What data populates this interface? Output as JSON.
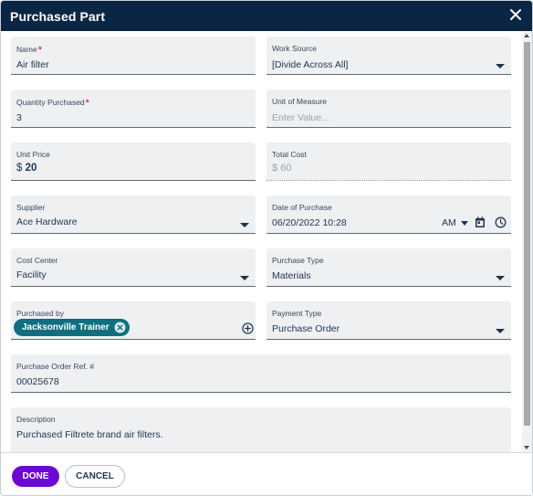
{
  "header": {
    "title": "Purchased Part",
    "close_icon": "close-icon"
  },
  "fields": {
    "name": {
      "label": "Name",
      "required_mark": "*",
      "value": "Air filter"
    },
    "work_source": {
      "label": "Work Source",
      "value": "[Divide Across All]"
    },
    "quantity": {
      "label": "Quantity Purchased",
      "required_mark": "*",
      "value": "3"
    },
    "unit_of_measure": {
      "label": "Unit of Measure",
      "placeholder": "Enter Value..."
    },
    "unit_price": {
      "label": "Unit Price",
      "currency": "$",
      "value": "20"
    },
    "total_cost": {
      "label": "Total Cost",
      "currency": "$",
      "value": "60"
    },
    "supplier": {
      "label": "Supplier",
      "value": "Ace Hardware"
    },
    "date_of_purchase": {
      "label": "Date of Purchase",
      "value": "06/20/2022 10:28",
      "ampm": "AM",
      "calendar_icon": "calendar-icon",
      "clock_icon": "clock-icon"
    },
    "cost_center": {
      "label": "Cost Center",
      "value": "Facility"
    },
    "purchase_type": {
      "label": "Purchase Type",
      "value": "Materials"
    },
    "purchased_by": {
      "label": "Purchased by",
      "chip": "Jacksonville Trainer",
      "add_icon": "add-circle-icon"
    },
    "payment_type": {
      "label": "Payment Type",
      "value": "Purchase Order"
    },
    "po_ref": {
      "label": "Purchase Order Ref. #",
      "value": "00025678"
    },
    "description": {
      "label": "Description",
      "value": "Purchased Filtrete brand air filters."
    }
  },
  "footer": {
    "done_label": "DONE",
    "cancel_label": "CANCEL"
  },
  "colors": {
    "header_bg": "#0b2545",
    "done_bg": "#6b08d6",
    "chip_bg": "#0f6e7f",
    "field_bg": "#eef0f2",
    "required": "#d0021b"
  }
}
